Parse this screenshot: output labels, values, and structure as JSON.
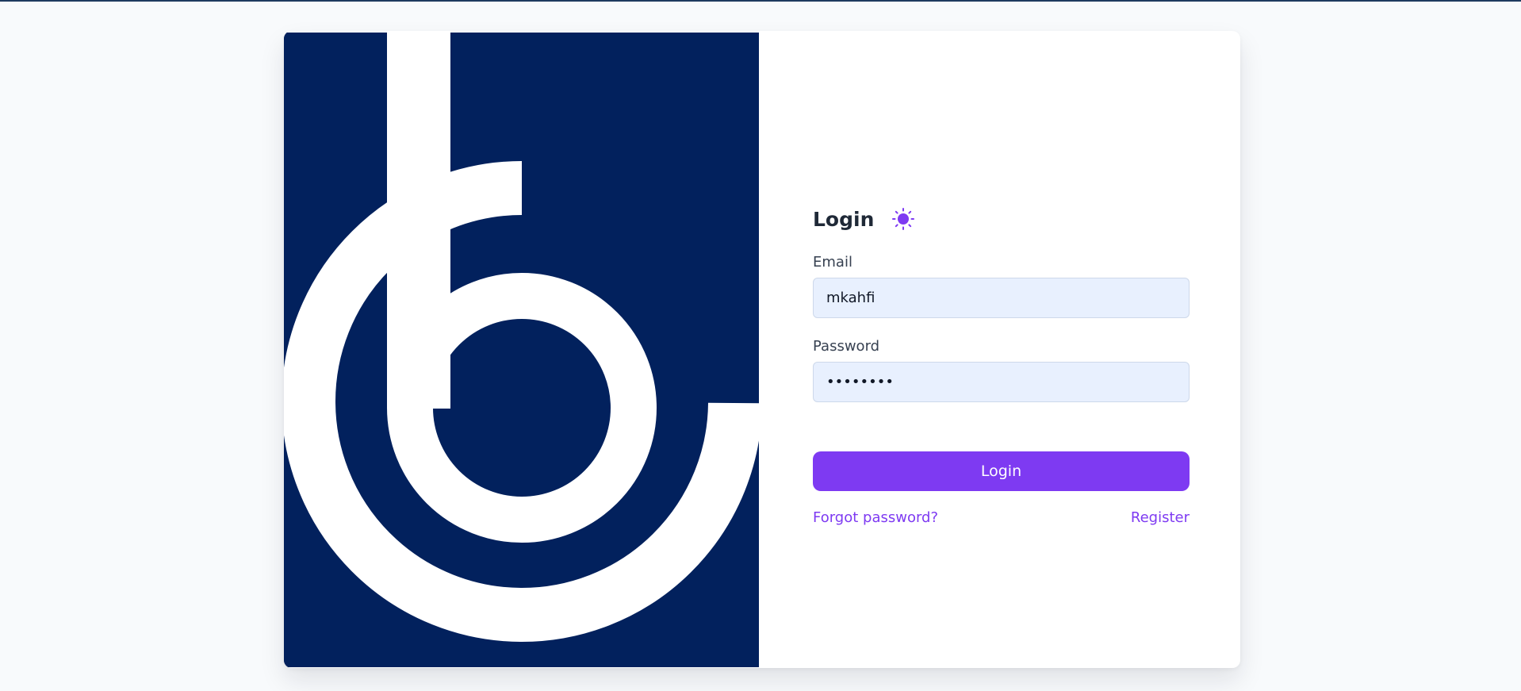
{
  "colors": {
    "page_bg": "#f8fafc",
    "logo_bg": "#02215d",
    "logo_fg": "#ffffff",
    "accent": "#7e3af2",
    "input_bg": "#e8f0fe"
  },
  "login": {
    "title": "Login",
    "theme_icon": "sun-icon",
    "email_label": "Email",
    "email_value": "mkahfi",
    "password_label": "Password",
    "password_value": "••••••••",
    "submit_label": "Login",
    "forgot_label": "Forgot password?",
    "register_label": "Register"
  }
}
